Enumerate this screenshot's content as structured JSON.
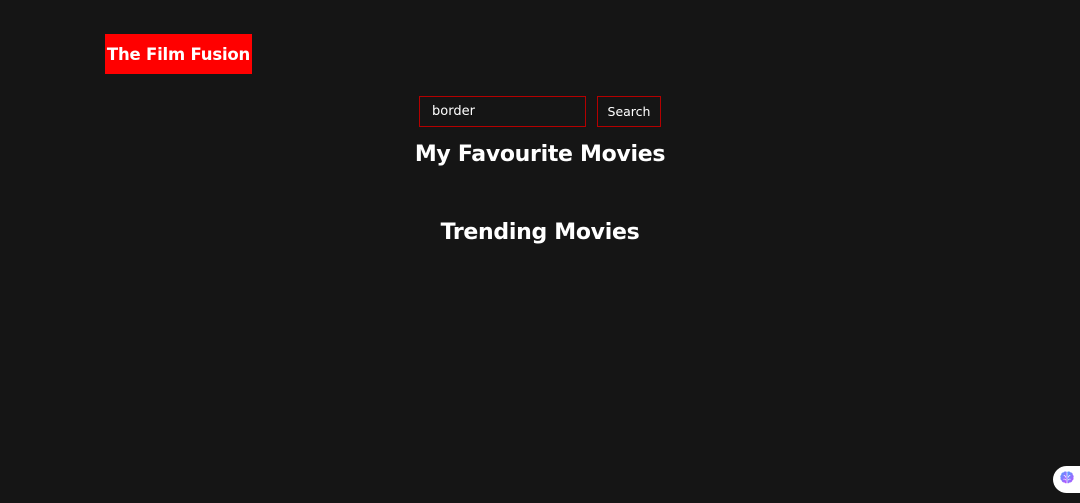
{
  "header": {
    "logo_text": "The Film Fusion",
    "logo_color": "#ff0000"
  },
  "search": {
    "value": "border",
    "button_label": "Search",
    "border_color": "#b40000"
  },
  "sections": {
    "favourites_title": "My Favourite Movies",
    "trending_title": "Trending Movies"
  },
  "widget": {
    "icon": "brain-icon"
  },
  "theme": {
    "background": "#151515",
    "text": "#ffffff"
  }
}
